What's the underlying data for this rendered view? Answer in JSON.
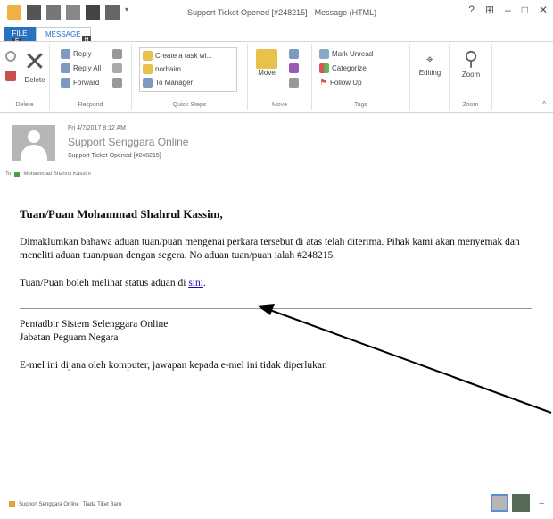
{
  "window": {
    "title": "Support Ticket Opened [#248215] - Message (HTML)",
    "help": "?",
    "controls": [
      "⊞",
      "–",
      "□",
      "✕"
    ]
  },
  "tabs": {
    "file": "FILE",
    "message": "MESSAGE",
    "file_key": "F",
    "message_key": "H"
  },
  "ribbon": {
    "delete": {
      "label": "Delete",
      "group": "Delete"
    },
    "respond": {
      "reply": "Reply",
      "reply_all": "Reply All",
      "forward": "Forward",
      "group": "Respond"
    },
    "quick_steps": {
      "items": [
        "Create a task wi...",
        "norhaim",
        "To Manager"
      ],
      "group": "Quick Steps"
    },
    "move": {
      "label": "Move",
      "group": "Move"
    },
    "tags": {
      "mark_unread": "Mark Unread",
      "categorize": "Categorize",
      "follow_up": "Follow Up",
      "group": "Tags"
    },
    "editing": {
      "label": "Editing"
    },
    "zoom": {
      "label": "Zoom",
      "group": "Zoom"
    }
  },
  "header": {
    "date": "Fri 4/7/2017 8:12 AM",
    "from": "Support Senggara Online",
    "subject": "Support Ticket Opened [#248215]",
    "to_prefix": "To",
    "to": "Mohammad Shahrul Kassim"
  },
  "message": {
    "greeting": "Tuan/Puan Mohammad Shahrul Kassim,",
    "para1": "Dimaklumkan bahawa aduan tuan/puan mengenai perkara tersebut di atas telah diterima. Pihak kami akan menyemak dan meneliti aduan tuan/puan dengan segera. No aduan tuan/puan ialah #248215.",
    "para2_before": "Tuan/Puan boleh melihat status aduan di ",
    "para2_link": "sini",
    "para2_after": ".",
    "sig_line1": "Pentadbir Sistem Selenggara Online",
    "sig_line2": "Jabatan Peguam Negara",
    "note": "E-mel ini dijana oleh komputer, jawapan kepada e-mel ini tidak diperlukan"
  },
  "footer": {
    "sender": "Support Senggara Online",
    "status": "Tiada Tiket Baru",
    "more": "–"
  },
  "colors": {
    "accent": "#2b71c2",
    "link": "#1a0dab",
    "arrow": "#000000"
  }
}
